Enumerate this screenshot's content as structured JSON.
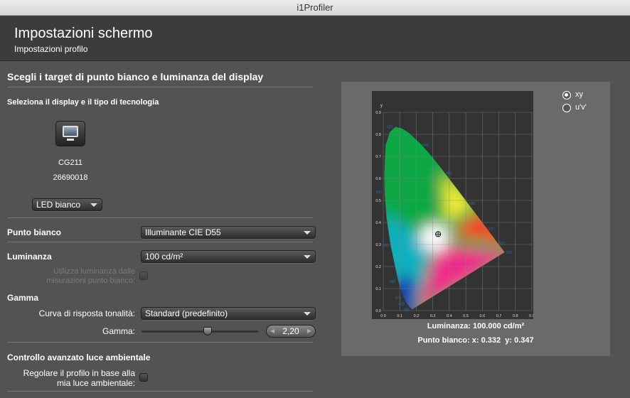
{
  "app_title": "i1Profiler",
  "header": {
    "title": "Impostazioni schermo",
    "subtitle": "Impostazioni profilo"
  },
  "section_title": "Scegli i target di punto bianco e luminanza del display",
  "display": {
    "heading": "Seleziona il display e il tipo di tecnologia",
    "model": "CG211",
    "serial": "26690018",
    "technology": "LED bianco"
  },
  "white_point": {
    "label": "Punto bianco",
    "value": "Illuminante CIE D55"
  },
  "luminance": {
    "label": "Luminanza",
    "value": "100 cd/m²",
    "use_measured_label": "Utilizza luminanza dalle misurazioni punto bianco:",
    "use_measured_checked": false
  },
  "gamma": {
    "heading": "Gamma",
    "curve_label": "Curva di risposta tonalità:",
    "curve_value": "Standard (predefinito)",
    "gamma_label": "Gamma:",
    "gamma_value": "2,20",
    "slider_fraction": 0.57
  },
  "ambient": {
    "heading": "Controllo avanzato luce ambientale",
    "adjust_label": "Regolare il profilo in base alla mia luce ambientale:",
    "adjust_checked": false
  },
  "diagram": {
    "mode_options": [
      {
        "label": "xy",
        "selected": true
      },
      {
        "label": "u'v'",
        "selected": false
      }
    ],
    "x_axis_label": "x",
    "y_axis_label": "y",
    "ticks": [
      "0.0",
      "0.1",
      "0.2",
      "0.3",
      "0.4",
      "0.5",
      "0.6",
      "0.7",
      "0.8",
      "0.9"
    ],
    "wavelengths": [
      {
        "nm": "380"
      },
      {
        "nm": "460"
      },
      {
        "nm": "470"
      },
      {
        "nm": "480"
      },
      {
        "nm": "490"
      },
      {
        "nm": "500"
      },
      {
        "nm": "520"
      },
      {
        "nm": "540"
      },
      {
        "nm": "560"
      },
      {
        "nm": "580"
      },
      {
        "nm": "600"
      },
      {
        "nm": "620"
      },
      {
        "nm": "700"
      }
    ],
    "white_point_xy": [
      0.332,
      0.347
    ],
    "luminance_text": "Luminanza: 100.000 cd/m²",
    "white_point_text_prefix": "Punto bianco:",
    "white_x_text": "x: 0.332",
    "white_y_text": "y: 0.347",
    "colors": {
      "background": "#333333",
      "grid": "#888888",
      "label": "#1f6fb0"
    }
  }
}
